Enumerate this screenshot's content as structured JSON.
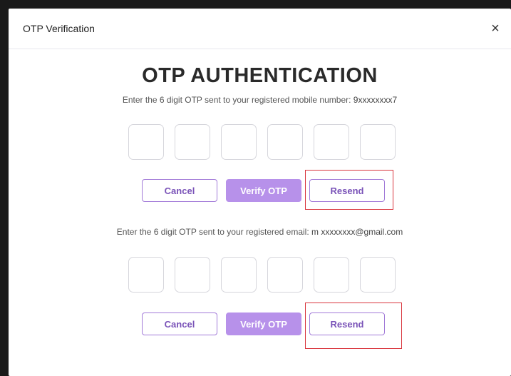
{
  "dialog": {
    "title": "OTP Verification",
    "close_label": "×",
    "heading": "OTP AUTHENTICATION"
  },
  "mobile": {
    "instruction": "Enter the 6 digit OTP sent to your registered mobile number: ",
    "masked_value": "9xxxxxxxx7",
    "otp_digits": [
      "",
      "",
      "",
      "",
      "",
      ""
    ],
    "cancel_label": "Cancel",
    "verify_label": "Verify OTP",
    "resend_label": "Resend"
  },
  "email": {
    "instruction": "Enter the 6 digit OTP sent to your registered email: ",
    "masked_value": "m xxxxxxxx@gmail.com",
    "otp_digits": [
      "",
      "",
      "",
      "",
      "",
      ""
    ],
    "cancel_label": "Cancel",
    "verify_label": "Verify OTP",
    "resend_label": "Resend"
  },
  "colors": {
    "accent": "#b791ea",
    "accent_text": "#7a53b8",
    "highlight": "#d9363e"
  }
}
